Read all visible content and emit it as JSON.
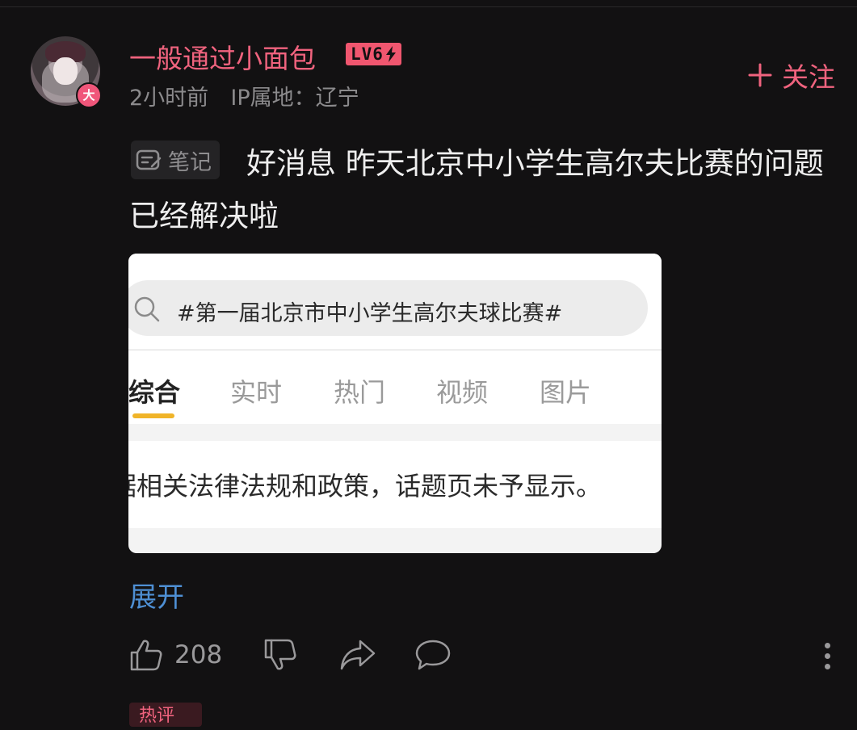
{
  "post": {
    "username": "一般通过小面包",
    "level": "LV6",
    "avatar_badge": "大",
    "time": "2小时前",
    "ip_location": "IP属地：辽宁",
    "follow_label": "关注",
    "note_tag": "笔记",
    "text": "好消息 昨天北京中小学生高尔夫比赛的问题已经解决啦",
    "expand_label": "展开",
    "like_count": "208",
    "hot_tag": "热评"
  },
  "screenshot": {
    "search_query": "#第一届北京市中小学生高尔夫球比赛#",
    "tabs": [
      {
        "label": "综合",
        "active": true
      },
      {
        "label": "实时",
        "active": false
      },
      {
        "label": "热门",
        "active": false
      },
      {
        "label": "视频",
        "active": false
      },
      {
        "label": "图片",
        "active": false
      }
    ],
    "notice": "据相关法律法规和政策，话题页未予显示。"
  },
  "colors": {
    "background": "#121112",
    "username": "#f0637e",
    "expand_link": "#4e8fd3",
    "tab_underline": "#f0b429"
  },
  "icons": [
    "search-icon",
    "plus-icon",
    "note-icon",
    "thumbs-up-icon",
    "thumbs-down-icon",
    "share-icon",
    "comment-icon",
    "more-icon"
  ]
}
